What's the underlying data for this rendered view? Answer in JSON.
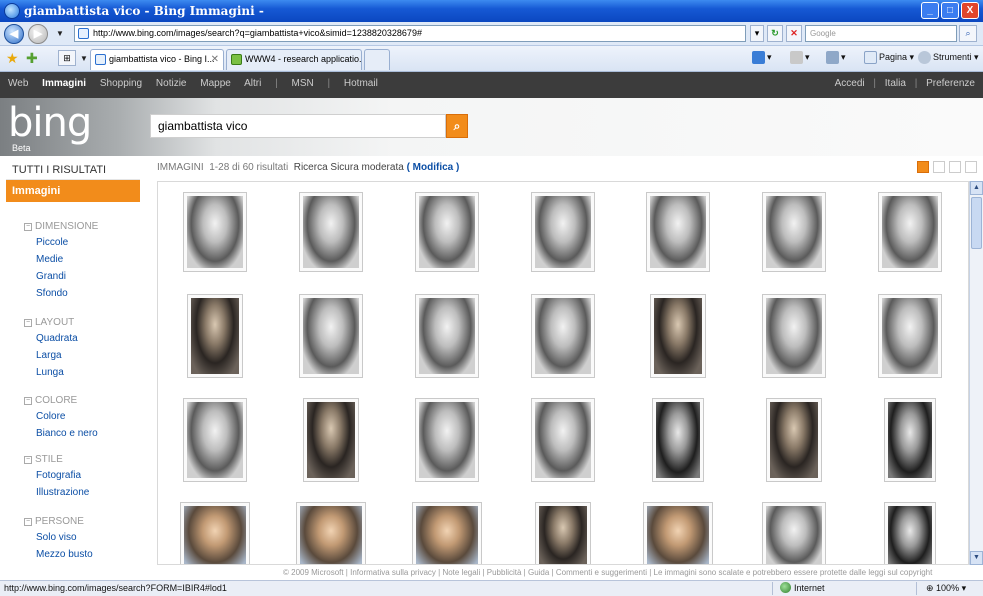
{
  "window": {
    "title": "giambattista vico - Bing Immagini -",
    "min_label": "_",
    "max_label": "□",
    "close_label": "X"
  },
  "address_bar": {
    "url": "http://www.bing.com/images/search?q=giambattista+vico&simid=1238820328679#",
    "search_placeholder": "Google",
    "nav_back_icon": "back-arrow-icon",
    "nav_forward_icon": "forward-arrow-icon"
  },
  "tabs": [
    {
      "label": "giambattista vico - Bing I...",
      "active": true
    },
    {
      "label": "WWW4 - research applicatio...",
      "active": false
    }
  ],
  "command_bar": {
    "page_label": "Pagina",
    "tools_label": "Strumenti"
  },
  "bing": {
    "nav_links": [
      "Web",
      "Immagini",
      "Shopping",
      "Notizie",
      "Mappe",
      "Altri",
      "MSN",
      "Hotmail"
    ],
    "selected_nav": "Immagini",
    "right_links": [
      "Accedi",
      "Italia",
      "Preferenze"
    ],
    "logo_text": "bing",
    "beta_label": "Beta",
    "query": "giambattista vico"
  },
  "sidebar": {
    "all_results": "TUTTI I RISULTATI",
    "current": "Immagini",
    "groups": [
      {
        "title": "DIMENSIONE",
        "items": [
          "Piccole",
          "Medie",
          "Grandi",
          "Sfondo"
        ]
      },
      {
        "title": "LAYOUT",
        "items": [
          "Quadrata",
          "Larga",
          "Lunga"
        ]
      },
      {
        "title": "COLORE",
        "items": [
          "Colore",
          "Bianco e nero"
        ]
      },
      {
        "title": "STILE",
        "items": [
          "Fotografia",
          "Illustrazione"
        ]
      },
      {
        "title": "PERSONE",
        "items": [
          "Solo viso",
          "Mezzo busto"
        ]
      }
    ]
  },
  "results": {
    "label": "IMMAGINI",
    "count_text": "1-28 di 60 risultati",
    "safe_search": "Ricerca Sicura moderata",
    "modify": "Modifica"
  },
  "footer": {
    "text": "© 2009 Microsoft | Informativa sulla privacy | Note legali | Pubblicità | Guida | Commenti e suggerimenti | Le immagini sono scalate e potrebbero essere protette dalle leggi sul copyright"
  },
  "status": {
    "url": "http://www.bing.com/images/search?FORM=IBIR4#lod1",
    "zone": "Internet",
    "zoom": "100%"
  },
  "colors": {
    "accent_orange": "#f28c1b",
    "link_blue": "#0b4ea5",
    "titlebar_blue": "#1659d4"
  },
  "thumbnails": [
    {
      "row": 0,
      "kind": "engraving"
    },
    {
      "row": 0,
      "kind": "engraving"
    },
    {
      "row": 0,
      "kind": "engraving"
    },
    {
      "row": 0,
      "kind": "engraving"
    },
    {
      "row": 0,
      "kind": "engraving"
    },
    {
      "row": 0,
      "kind": "engraving"
    },
    {
      "row": 0,
      "kind": "engraving"
    },
    {
      "row": 1,
      "kind": "dark-portrait"
    },
    {
      "row": 1,
      "kind": "engraving"
    },
    {
      "row": 1,
      "kind": "engraving"
    },
    {
      "row": 1,
      "kind": "engraving"
    },
    {
      "row": 1,
      "kind": "dark-portrait"
    },
    {
      "row": 1,
      "kind": "engraving"
    },
    {
      "row": 1,
      "kind": "engraving"
    },
    {
      "row": 2,
      "kind": "engraving"
    },
    {
      "row": 2,
      "kind": "dark-portrait"
    },
    {
      "row": 2,
      "kind": "engraving"
    },
    {
      "row": 2,
      "kind": "engraving"
    },
    {
      "row": 2,
      "kind": "photo"
    },
    {
      "row": 2,
      "kind": "dark-portrait"
    },
    {
      "row": 2,
      "kind": "photo"
    },
    {
      "row": 3,
      "kind": "color-portrait"
    },
    {
      "row": 3,
      "kind": "color-portrait"
    },
    {
      "row": 3,
      "kind": "color-portrait"
    },
    {
      "row": 3,
      "kind": "dark-portrait"
    },
    {
      "row": 3,
      "kind": "color-portrait"
    },
    {
      "row": 3,
      "kind": "engraving"
    },
    {
      "row": 3,
      "kind": "photo"
    }
  ]
}
